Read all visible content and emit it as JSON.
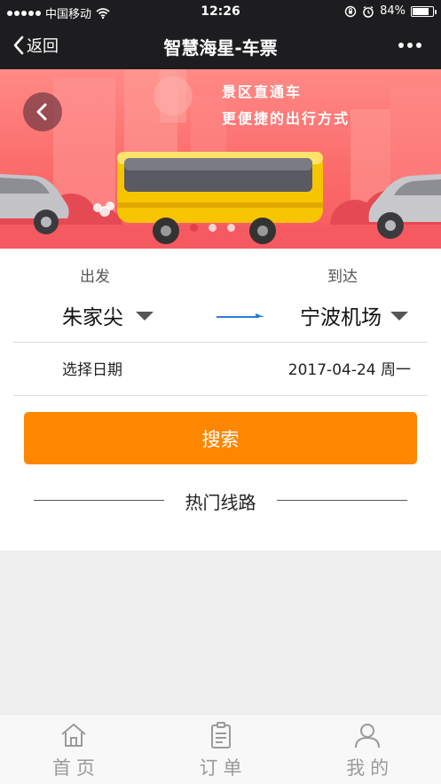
{
  "status_bar": {
    "carrier": "中国移动",
    "time": "12:26",
    "battery": "84%",
    "battery_level": 0.84
  },
  "nav": {
    "back_label": "返回",
    "title": "智慧海星-车票",
    "more_icon": "more-dots-icon"
  },
  "banner": {
    "line1": "景区直通车",
    "line2": "更便捷的出行方式",
    "back_icon": "chevron-left-icon",
    "carousel": {
      "count": 3,
      "active_index": 0
    },
    "colors": {
      "active_dot": "#e0404a",
      "inactive_dot": "#f7d2d2"
    }
  },
  "form": {
    "depart_label": "出发",
    "arrive_label": "到达",
    "from_station": "朱家尖",
    "to_station": "宁波机场",
    "date_label": "选择日期",
    "date_value": "2017-04-24 周一",
    "search_label": "搜索",
    "hot_routes_label": "热门线路"
  },
  "tabs": [
    {
      "label": "首页",
      "icon": "home-icon"
    },
    {
      "label": "订单",
      "icon": "clipboard-icon"
    },
    {
      "label": "我的",
      "icon": "user-icon"
    }
  ],
  "colors": {
    "accent": "#fd8700",
    "arrow": "#2a7fd4",
    "nav_bg": "#1d1d1f"
  }
}
